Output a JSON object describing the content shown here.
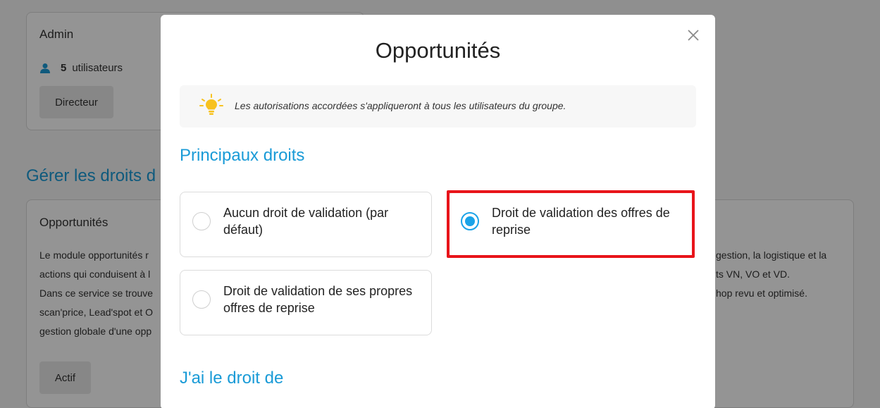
{
  "background": {
    "admin_card": {
      "title": "Admin",
      "user_count": "5",
      "users_label": "utilisateurs",
      "role_chip": "Directeur"
    },
    "manage_title": "Gérer les droits d",
    "opportunities_card": {
      "title": "Opportunités",
      "description_left": [
        "Le module opportunités r",
        "actions qui conduisent à l",
        "Dans ce service se trouve",
        "scan'price, Lead'spot et O",
        "gestion globale d'une opp"
      ],
      "description_right": [
        "gestion, la logistique et la",
        "ts VN, VO et VD.",
        "hop revu et optimisé."
      ],
      "status_chip": "Actif"
    }
  },
  "modal": {
    "title": "Opportunités",
    "info_text": "Les autorisations accordées s'appliqueront à tous les utilisateurs du groupe.",
    "main_rights_title": "Principaux droits",
    "options": [
      {
        "label": "Aucun droit de validation (par défaut)",
        "selected": false
      },
      {
        "label": "Droit de validation des offres de reprise",
        "selected": true
      },
      {
        "label": "Droit de validation de ses propres offres de reprise",
        "selected": false
      }
    ],
    "rights_title": "J'ai le droit de"
  },
  "colors": {
    "accent": "#1a9bd7",
    "radio_selected": "#1aa3e8",
    "highlight": "#e8141a",
    "bulb": "#f7c21f"
  }
}
